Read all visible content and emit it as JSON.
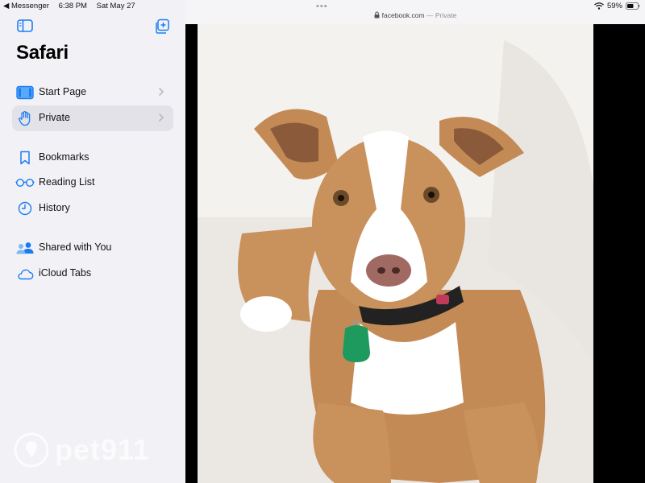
{
  "status_bar": {
    "back_app": "◀ Messenger",
    "time": "6:38 PM",
    "date": "Sat May 27",
    "battery": "59%"
  },
  "sidebar": {
    "title": "Safari",
    "items": [
      {
        "label": "Start Page",
        "icon": "start-page-icon",
        "chevron": true
      },
      {
        "label": "Private",
        "icon": "hand-icon",
        "chevron": true,
        "selected": true
      },
      {
        "label": "Bookmarks",
        "icon": "bookmark-icon"
      },
      {
        "label": "Reading List",
        "icon": "glasses-icon"
      },
      {
        "label": "History",
        "icon": "clock-icon"
      },
      {
        "label": "Shared with You",
        "icon": "shared-with-you-icon"
      },
      {
        "label": "iCloud Tabs",
        "icon": "cloud-icon"
      }
    ]
  },
  "address_bar": {
    "domain": "facebook.com",
    "separator": "—",
    "mode": "Private"
  },
  "watermark": {
    "text": "pet911"
  },
  "colors": {
    "sidebar_bg": "#f2f2f6",
    "accent": "#1a7cf5",
    "selected_bg": "#e2e2e8",
    "dog_tag": "#1e9a5e",
    "dog_fur": "#c9915c"
  }
}
